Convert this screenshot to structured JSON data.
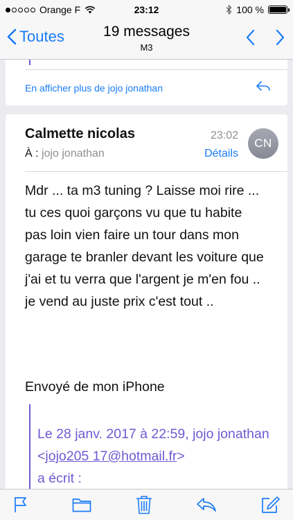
{
  "status_bar": {
    "carrier": "Orange F",
    "time": "23:12",
    "battery": "100 %",
    "battery_level": 1.0,
    "signal_bars_filled": 1
  },
  "nav": {
    "back_label": "Toutes",
    "title": "19 messages",
    "subtitle": "M3"
  },
  "previous_message": {
    "show_more_link": "En afficher plus de jojo jonathan"
  },
  "message": {
    "sender": "Calmette nicolas",
    "to_label": "À :",
    "to_name": "jojo jonathan",
    "time": "23:02",
    "details_label": "Détails",
    "avatar_initials": "CN",
    "body": "Mdr ... ta m3 tuning ? Laisse moi rire ...\ntu ces quoi garçons vu que tu habite pas loin vien faire un tour dans mon garage te branler devant les voiture que j'ai et tu verra que l'argent je m'en fou .. je vend au juste prix c'est tout ..",
    "signature": "Envoyé de mon iPhone",
    "quote_prefix": "Le 28 janv. 2017 à 22:59, jojo jonathan <",
    "quote_email": "jojo205 17@hotmail.fr",
    "quote_suffix": ">",
    "quote_end": "a écrit :"
  },
  "colors": {
    "accent": "#1a7cf5",
    "quote": "#6c5bd3",
    "background": "#ececf0"
  },
  "icons": [
    "chevron-left-icon",
    "chevron-up-icon",
    "chevron-down-icon",
    "reply-icon",
    "flag-icon",
    "folder-icon",
    "trash-icon",
    "compose-icon"
  ]
}
